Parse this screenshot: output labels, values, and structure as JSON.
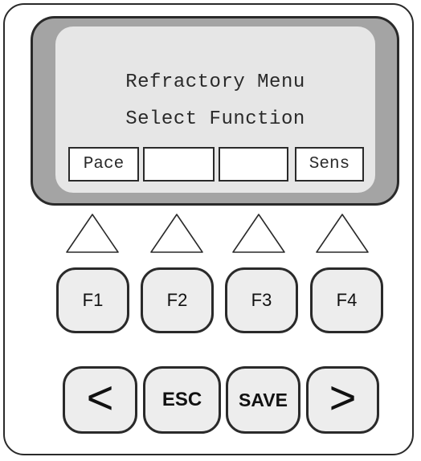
{
  "display": {
    "line1": "Refractory Menu",
    "line2": "Select Function",
    "softkeys": [
      "Pace",
      "",
      "",
      "Sens"
    ]
  },
  "function_keys": [
    "F1",
    "F2",
    "F3",
    "F4"
  ],
  "nav_keys": {
    "back": "<",
    "escape": "ESC",
    "save": "SAVE",
    "forward": ">"
  },
  "colors": {
    "bezel": "#a4a4a4",
    "lcd_background": "#e6e6e6",
    "key_face": "#ededed",
    "outline": "#2a2a2a"
  }
}
